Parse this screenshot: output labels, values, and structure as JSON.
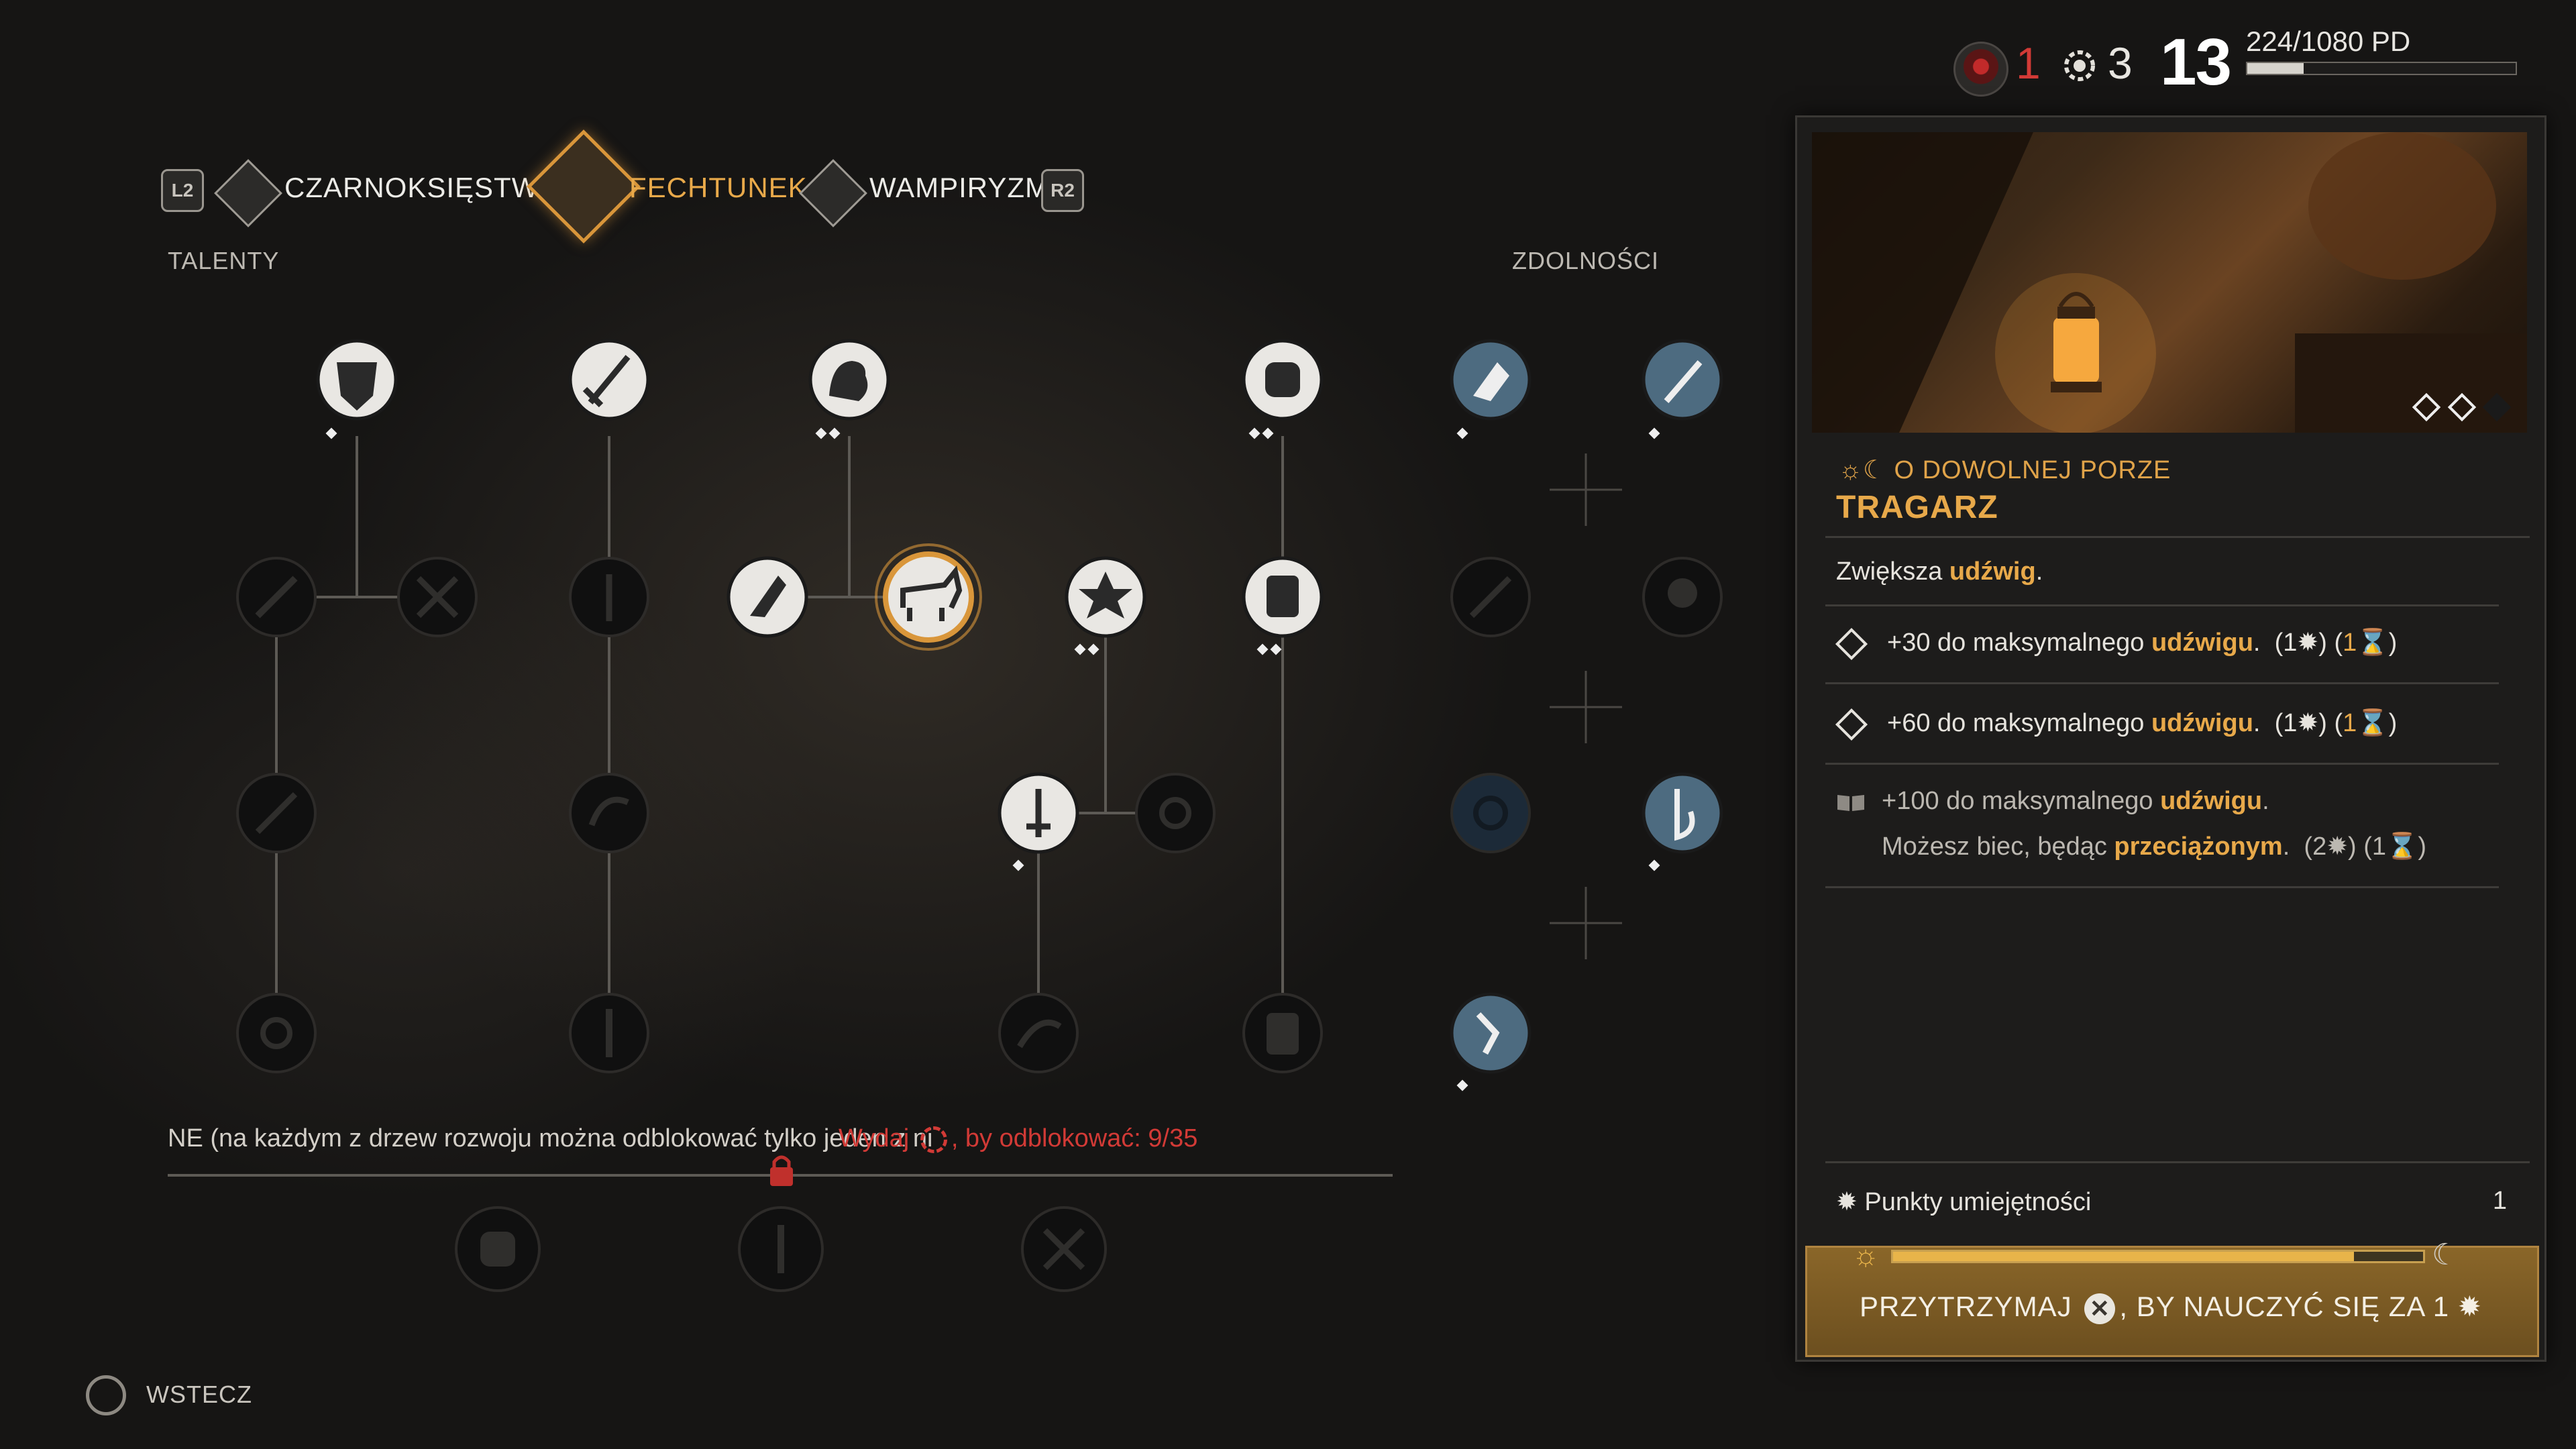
{
  "status": {
    "vampire_points": "1",
    "skill_points": "3",
    "level": "13",
    "xp_text": "224/1080 PD",
    "xp_fraction": 0.21,
    "vampire_icon": "vampire-blood-icon",
    "skill_icon": "skill-point-icon"
  },
  "tabs": {
    "prev_button": "L2",
    "next_button": "R2",
    "items": [
      {
        "label": "CZARNOKSIĘSTWO",
        "icon": "sorcery-icon"
      },
      {
        "label": "FECHTUNEK",
        "icon": "swordplay-icon",
        "active": true
      },
      {
        "label": "WAMPIRYZM",
        "icon": "vampirism-icon"
      }
    ]
  },
  "sections": {
    "talents": "TALENTY",
    "abilities": "ZDOLNOŚCI"
  },
  "restriction": {
    "text": "NE (na każdym z drzew rozwoju można odblokować tylko jeden z ni",
    "spend_prefix": "Wydaj",
    "spend_suffix": ", by odblokować: 9/35"
  },
  "back": {
    "label": "WSTECZ",
    "icon": "circle-button-icon"
  },
  "panel": {
    "time_label": "O DOWOLNEJ PORZE",
    "title": "TRAGARZ",
    "desc_prefix": "Zwiększa ",
    "desc_highlight": "udźwig",
    "desc_suffix": ".",
    "levels": [
      {
        "prefix": "+30 do maksymalnego ",
        "highlight": "udźwigu",
        "suffix": ".",
        "cost_points": "1",
        "cost_hours": "1"
      },
      {
        "prefix": "+60 do maksymalnego ",
        "highlight": "udźwigu",
        "suffix": ".",
        "cost_points": "1",
        "cost_hours": "1"
      },
      {
        "prefix": "+100 do maksymalnego ",
        "highlight": "udźwigu",
        "suffix": ".",
        "line2_prefix": "Możesz biec, będąc ",
        "line2_highlight": "przeciążonym",
        "line2_suffix": ".",
        "cost_points": "2",
        "cost_hours": "1"
      }
    ],
    "skill_points_label": "Punkty umiejętności",
    "skill_points_value": "1",
    "time_progress": 0.87,
    "learn_prefix": "PRZYTRZYMAJ",
    "learn_button": "✕",
    "learn_suffix": ", BY NAUCZYĆ SIĘ ZA 1"
  }
}
